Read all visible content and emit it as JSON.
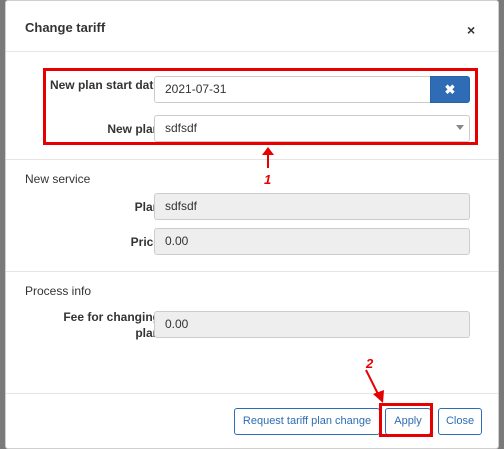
{
  "dialog": {
    "title": "Change tariff",
    "close_glyph": "×"
  },
  "tariff": {
    "start_date_label": "New plan start date",
    "start_date_value": "2021-07-31",
    "clear_glyph": "✖",
    "new_plan_label": "New plan",
    "new_plan_value": "sdfsdf"
  },
  "new_service": {
    "heading": "New service",
    "plan_label": "Plan",
    "plan_value": "sdfsdf",
    "price_label": "Price",
    "price_value": "0.00"
  },
  "process_info": {
    "heading": "Process info",
    "fee_label": "Fee for changing plan",
    "fee_value": "0.00"
  },
  "footer": {
    "request_label": "Request tariff plan change",
    "apply_label": "Apply",
    "close_label": "Close"
  },
  "annotations": {
    "marker_1": "1",
    "marker_2": "2",
    "highlight_color": "#e60000"
  },
  "colors": {
    "accent": "#2e6cb5"
  }
}
